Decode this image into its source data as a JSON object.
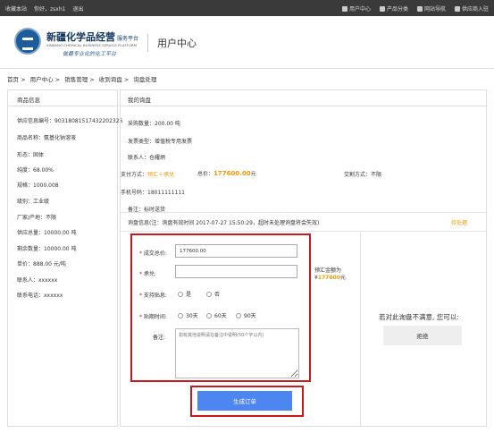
{
  "topbar": {
    "bookmark": "收藏本站",
    "greeting": "你好，zsxh1",
    "logout": "退出",
    "user_center": "用户中心",
    "categories": "产品分类",
    "site_nav": "网站导航",
    "supplier": "供应商入驻"
  },
  "header": {
    "brand_name": "新疆化学品经营",
    "brand_suffix": "服务平台",
    "brand_en": "XINJIANG CHEMICAL BUSINESS SERVICE PLATFORM",
    "slogan": "做最专业化的化工平台",
    "page_title": "用户中心"
  },
  "breadcrumb": [
    "首页 >",
    "用户中心 >",
    "销售管理 >",
    "收到询盘 >",
    "询盘处理"
  ],
  "product": {
    "title": "商品信息",
    "supply_no": "供应信息编号：90318081517432202326",
    "name": "商品名称：氨基化钠溶液",
    "form": "形态：固体",
    "purity": "纯度：68.00%",
    "spec": "规格：1000.008",
    "grade": "级别：工业级",
    "maker": "厂家/产地：不限",
    "total": "供应总量：10000.00 吨",
    "remain": "剩余数量：10000.00 吨",
    "price": "单价：888.00 元/吨",
    "contact": "联系人：xxxxxx",
    "phone": "联系电话：xxxxxx"
  },
  "inquiry": {
    "title": "我的询盘",
    "qty": "采购数量：200.00 吨",
    "invoice": "发票类型：增值税专用发票",
    "contact": "联系人：仓耀炳",
    "pay_label": "支付方式：",
    "pay_value": "预汇＋承兑",
    "total_label": "总价：",
    "total_value": "177600.00",
    "total_unit": "元",
    "deal": "交割方式：不限",
    "mobile": "手机号码：18011111111",
    "remark": "备注：标时送货",
    "info": "询盘信息(注：询盘有效时间 2017-07-27 15:50:29，超时未处理询盘将会失效)",
    "status": "待处理"
  },
  "form": {
    "deal_price_label": "成交总价:",
    "deal_price_value": "177600.00",
    "acceptance_label": "承兑:",
    "acceptance_value": "",
    "wire_label": "预汇金额为",
    "wire_value": "177600",
    "wire_unit": "元",
    "interest_label": "支持贴息:",
    "opt_yes": "是",
    "opt_no": "否",
    "period_label": "贴期时间:",
    "opt_30": "30天",
    "opt_60": "60天",
    "opt_90": "90天",
    "remark_label": "备注:",
    "remark_placeholder": "如有其他说明请在备注中说明(50个字以内)",
    "submit": "生成订单"
  },
  "refuse": {
    "question": "若对此询盘不满意, 您可以:",
    "button": "拒绝"
  }
}
